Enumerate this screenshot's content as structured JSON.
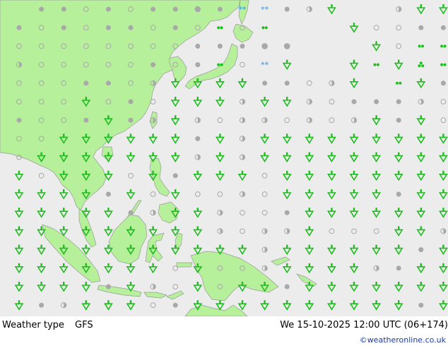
{
  "footer": {
    "product_label": "Weather type",
    "model_label": "GFS",
    "datetime_label": "We 15-10-2025 12:00 UTC (06+174)",
    "credit": "©weatheronline.co.uk"
  },
  "colors": {
    "sea": "#ececec",
    "land": "#b6f09a",
    "coast": "#999999",
    "rain_symbol": "#22bb22",
    "snow_symbol": "#1e90ff",
    "cloud_symbol": "#a8a8a8"
  },
  "symbol_legend": {
    "rain": "rain-shower-icon",
    "drizzle": "drizzle-icon",
    "snow": "snow-icon",
    "overcast": "overcast-icon",
    "cloudy": "cloudy-icon",
    "partly_cloudy": "partly-cloudy-icon",
    "clear": "clear-icon"
  },
  "symbol_grid": {
    "rows": [
      "sffvfvffofhhfcr..crrrrcr",
      "fvfvffvfvdvd...rvvfffffc",
      "vvvvvvvvfffoo...rvddvfffc",
      "cvvvvvfvfdvhr..rdrtddcddd",
      "vvvffvcrrrrffvcr.drfrffcf",
      "vvvrvfvrrrcrrcvfffcvfcfvc",
      "fvvfrfcrcvccvcvcrfrvvvccf",
      "vvrrrrrrfrcrrrrrrrrrrrrrr",
      "vrrrrrrrcrcrrrrrrrrrrrrrf",
      "rvrrrvrfrrrvrrrrrrrrrrrrf",
      "rrrrfrvrvvcvrrrrrfrrrrrrv",
      "rrrrrfcrrcvvfrrrrrrrcrvvc",
      "rrrrrrrrrcvccrvvvrrcvrrvr",
      "rrrrrrrrrrrcrrrrrrfrcrrrc",
      "rrrrrrrvrvvcrrrrcfrrrcvrr",
      "rrrrfrcvrvrrfrrrrrrrrrrrf",
      "rfcrrrvfrrrrrrrrrrfrrrrrr"
    ]
  }
}
